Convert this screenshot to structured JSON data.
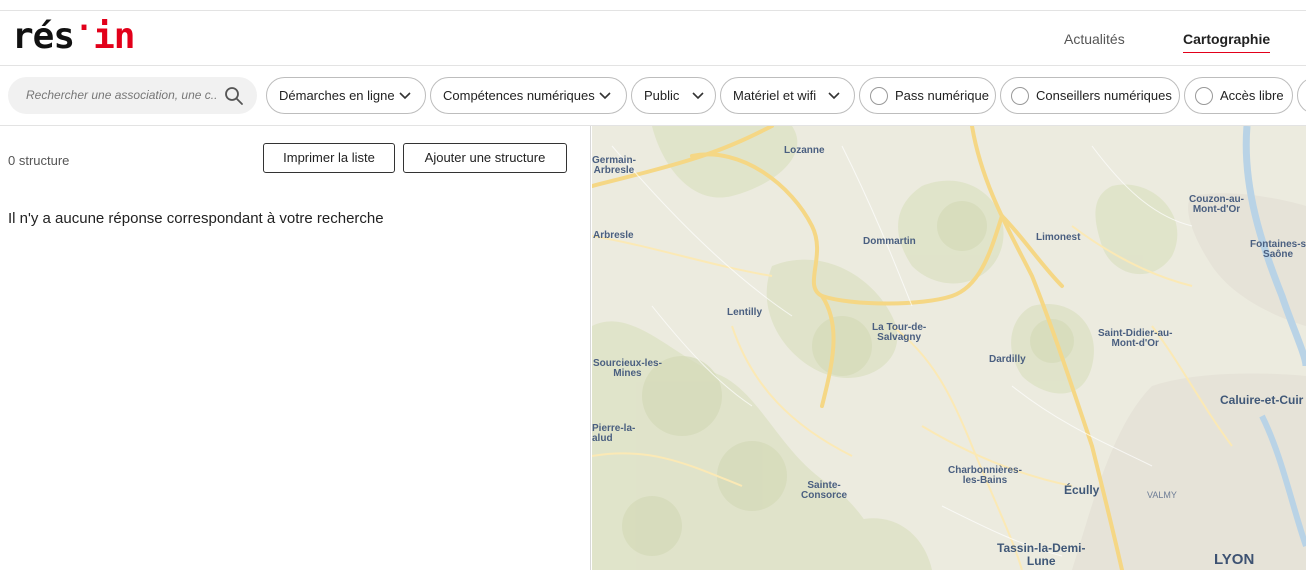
{
  "header": {
    "logo": {
      "part1": "rés",
      "dot": "·",
      "part2": "in"
    },
    "nav": [
      {
        "label": "Actualités",
        "active": false
      },
      {
        "label": "Cartographie",
        "active": true
      }
    ],
    "accent_color": "#e2001a"
  },
  "filters": {
    "search": {
      "placeholder": "Rechercher une association, une c...",
      "icon": "search-icon"
    },
    "dropdowns": [
      {
        "label": "Démarches en ligne"
      },
      {
        "label": "Compétences numériques"
      },
      {
        "label": "Public"
      },
      {
        "label": "Matériel et wifi"
      }
    ],
    "checkboxes": [
      {
        "label": "Pass numérique",
        "checked": false
      },
      {
        "label": "Conseillers numériques",
        "checked": false
      },
      {
        "label": "Accès libre",
        "checked": false
      }
    ]
  },
  "results": {
    "count_label": "0 structure",
    "print_button": "Imprimer la liste",
    "add_button": "Ajouter une structure",
    "empty_message": "Il n'y a aucune réponse correspondant à votre recherche"
  },
  "map": {
    "places": [
      {
        "name": "Germain-\nArbresle"
      },
      {
        "name": "Lozanne"
      },
      {
        "name": "Couzon-au-\nMont-d'Or"
      },
      {
        "name": "Arbresle"
      },
      {
        "name": "Dommartin"
      },
      {
        "name": "Limonest"
      },
      {
        "name": "Fontaines-s\nSaône"
      },
      {
        "name": "Lentilly"
      },
      {
        "name": "La Tour-de-\nSalvagny"
      },
      {
        "name": "Saint-Didier-au-\nMont-d'Or"
      },
      {
        "name": "Sourcieux-les-\nMines"
      },
      {
        "name": "Dardilly"
      },
      {
        "name": "Caluire-et-Cuir"
      },
      {
        "name": "Pierre-la-\nalud"
      },
      {
        "name": "Charbonnières-\nles-Bains"
      },
      {
        "name": "Sainte-\nConsorce"
      },
      {
        "name": "Écully"
      },
      {
        "name": "VALMY"
      },
      {
        "name": "Tassin-la-Demi-\nLune"
      },
      {
        "name": "LYON"
      }
    ]
  }
}
